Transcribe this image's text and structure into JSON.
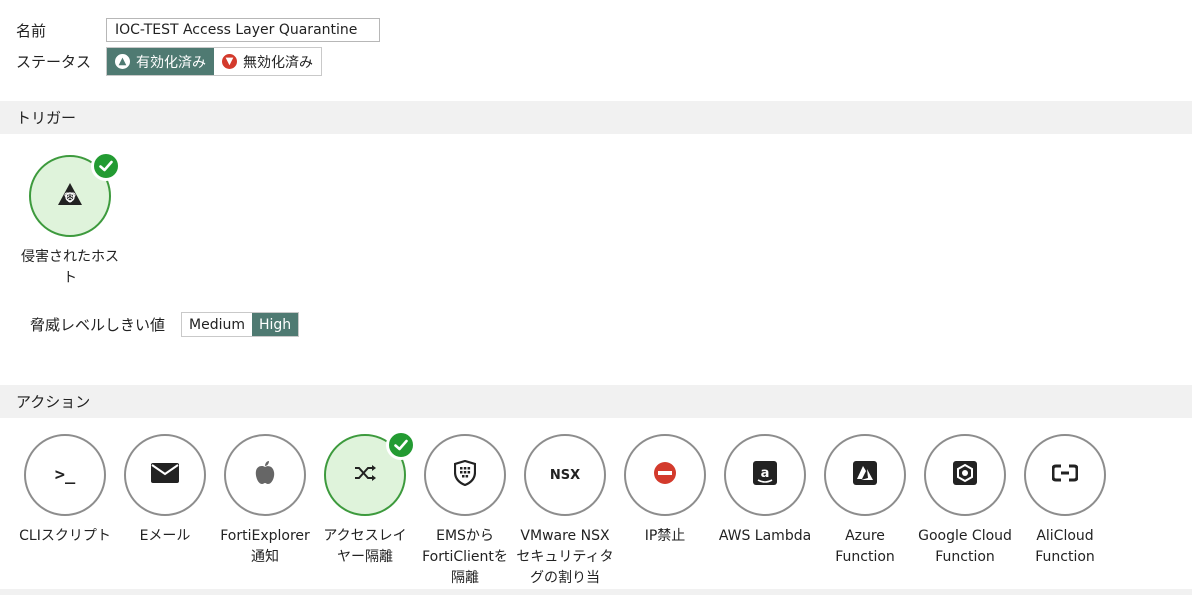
{
  "form": {
    "name_label": "名前",
    "name_value": "IOC-TEST Access Layer Quarantine",
    "status_label": "ステータス",
    "status_options": [
      "有効化済み",
      "無効化済み"
    ],
    "status_selected": "有効化済み"
  },
  "trigger": {
    "section_title": "トリガー",
    "items": [
      {
        "label": "侵害されたホスト",
        "icon": "biohazard-icon",
        "selected": true
      }
    ],
    "threshold_label": "脅威レベルしきい値",
    "threshold_options": [
      "Medium",
      "High"
    ],
    "threshold_selected": "High"
  },
  "actions": {
    "section_title": "アクション",
    "items": [
      {
        "label": "CLIスクリプト",
        "icon": "terminal-icon",
        "glyph": ">_",
        "selected": false
      },
      {
        "label": "Eメール",
        "icon": "envelope-icon",
        "glyph": "",
        "selected": false
      },
      {
        "label": "FortiExplorer 通知",
        "icon": "apple-icon",
        "glyph": "",
        "selected": false
      },
      {
        "label": "アクセスレイヤー隔離",
        "icon": "shuffle-icon",
        "glyph": "",
        "selected": true
      },
      {
        "label": "EMSからFortiClientを隔離",
        "icon": "shield-grid-icon",
        "glyph": "",
        "selected": false
      },
      {
        "label": "VMware NSX セキュリティタグの割り当",
        "icon": "nsx-icon",
        "glyph": "NSX",
        "selected": false
      },
      {
        "label": "IP禁止",
        "icon": "ban-icon",
        "glyph": "",
        "selected": false
      },
      {
        "label": "AWS Lambda",
        "icon": "amazon-icon",
        "glyph": "",
        "selected": false
      },
      {
        "label": "Azure Function",
        "icon": "azure-icon",
        "glyph": "",
        "selected": false
      },
      {
        "label": "Google Cloud Function",
        "icon": "google-cloud-icon",
        "glyph": "",
        "selected": false
      },
      {
        "label": "AliCloud Function",
        "icon": "alicloud-icon",
        "glyph": "",
        "selected": false
      }
    ]
  },
  "colors": {
    "accent": "#4f7a72",
    "selected_fill": "#dff3db",
    "check_green": "#239b32",
    "danger": "#d33a2c",
    "section_bg": "#f1f1f1"
  }
}
